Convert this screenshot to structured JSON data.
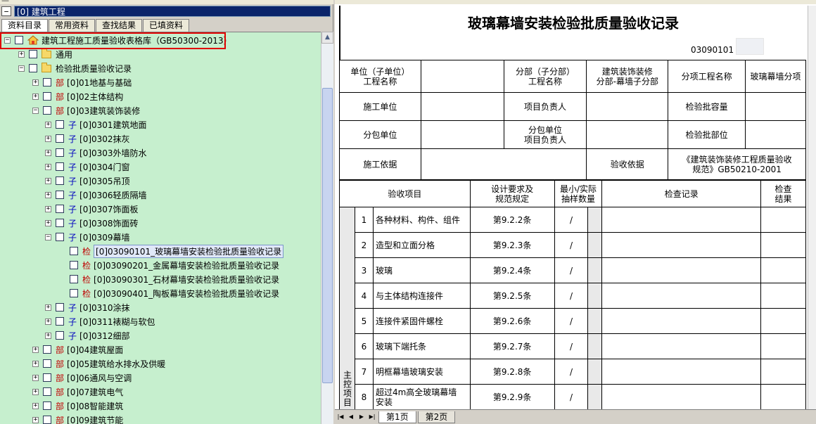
{
  "left": {
    "top_strip_text": "—",
    "project_toggle": "−",
    "project_name": "[0] 建筑工程",
    "tabs": [
      "资料目录",
      "常用资料",
      "查找结果",
      "已填资料"
    ],
    "tree": [
      {
        "id": "root",
        "exp": "−",
        "badge": "",
        "label": "建筑工程施工质量验收表格库（GB50300-2013）"
      },
      {
        "id": "tongyong",
        "exp": "+",
        "badge": "",
        "label": "通用"
      },
      {
        "id": "jianyan",
        "exp": "−",
        "badge": "",
        "label": "检验批质量验收记录"
      },
      {
        "id": "p01",
        "exp": "+",
        "badge": "部",
        "label": "[0]01地基与基础"
      },
      {
        "id": "p02",
        "exp": "+",
        "badge": "部",
        "label": "[0]02主体结构"
      },
      {
        "id": "p03",
        "exp": "−",
        "badge": "部",
        "label": "[0]03建筑装饰装修"
      },
      {
        "id": "s0301",
        "exp": "+",
        "badge": "子",
        "label": "[0]0301建筑地面"
      },
      {
        "id": "s0302",
        "exp": "+",
        "badge": "子",
        "label": "[0]0302抹灰"
      },
      {
        "id": "s0303",
        "exp": "+",
        "badge": "子",
        "label": "[0]0303外墙防水"
      },
      {
        "id": "s0304",
        "exp": "+",
        "badge": "子",
        "label": "[0]0304门窗"
      },
      {
        "id": "s0305",
        "exp": "+",
        "badge": "子",
        "label": "[0]0305吊顶"
      },
      {
        "id": "s0306",
        "exp": "+",
        "badge": "子",
        "label": "[0]0306轻质隔墙"
      },
      {
        "id": "s0307",
        "exp": "+",
        "badge": "子",
        "label": "[0]0307饰面板"
      },
      {
        "id": "s0308",
        "exp": "+",
        "badge": "子",
        "label": "[0]0308饰面砖"
      },
      {
        "id": "s0309",
        "exp": "−",
        "badge": "子",
        "label": "[0]0309幕墙"
      },
      {
        "id": "j0309001",
        "exp": "",
        "badge": "检",
        "label": "[0]03090101_玻璃幕墙安装检验批质量验收记录"
      },
      {
        "id": "j0309002",
        "exp": "",
        "badge": "检",
        "label": "[0]03090201_金属幕墙安装检验批质量验收记录"
      },
      {
        "id": "j0309003",
        "exp": "",
        "badge": "检",
        "label": "[0]03090301_石材幕墙安装检验批质量验收记录"
      },
      {
        "id": "j0309004",
        "exp": "",
        "badge": "检",
        "label": "[0]03090401_陶板幕墙安装检验批质量验收记录"
      },
      {
        "id": "s0310",
        "exp": "+",
        "badge": "子",
        "label": "[0]0310涂抹"
      },
      {
        "id": "s0311",
        "exp": "+",
        "badge": "子",
        "label": "[0]0311裱糊与软包"
      },
      {
        "id": "s0312",
        "exp": "+",
        "badge": "子",
        "label": "[0]0312细部"
      },
      {
        "id": "p04",
        "exp": "+",
        "badge": "部",
        "label": "[0]04建筑屋面"
      },
      {
        "id": "p05",
        "exp": "+",
        "badge": "部",
        "label": "[0]05建筑给水排水及供暖"
      },
      {
        "id": "p06",
        "exp": "+",
        "badge": "部",
        "label": "[0]06通风与空调"
      },
      {
        "id": "p07",
        "exp": "+",
        "badge": "部",
        "label": "[0]07建筑电气"
      },
      {
        "id": "p08",
        "exp": "+",
        "badge": "部",
        "label": "[0]08智能建筑"
      },
      {
        "id": "p09",
        "exp": "+",
        "badge": "部",
        "label": "[0]09建筑节能"
      }
    ]
  },
  "doc": {
    "title": "玻璃幕墙安装检验批质量验收记录",
    "code": "03090101",
    "header": {
      "unit_label": "单位（子单位）\n工程名称",
      "fenbu_label": "分部（子分部）\n工程名称",
      "fenbu_value": "建筑装饰装修\n分部-幕墙子分部",
      "fenxiang_label": "分项工程名称",
      "fenxiang_value": "玻璃幕墙分项",
      "shigong_label": "施工单位",
      "xiangmu_label": "项目负责人",
      "rongliang_label": "检验批容量",
      "fenbao_label": "分包单位",
      "fenbao_fz_label": "分包单位\n项目负责人",
      "buwei_label": "检验批部位",
      "yiju_label": "施工依据",
      "yanshou_label": "验收依据",
      "yanshou_value": "《建筑装饰装修工程质量验收\n规范》GB50210-2001"
    },
    "columns": {
      "item": "验收项目",
      "design": "设计要求及\n规范规定",
      "sample": "最小/实际\n抽样数量",
      "record": "检查记录",
      "result": "检查\n结果"
    },
    "group_label": "主控项目",
    "items": [
      {
        "no": "1",
        "name": "各种材料、构件、组件",
        "clause": "第9.2.2条",
        "slash": "/"
      },
      {
        "no": "2",
        "name": "造型和立面分格",
        "clause": "第9.2.3条",
        "slash": "/"
      },
      {
        "no": "3",
        "name": "玻璃",
        "clause": "第9.2.4条",
        "slash": "/"
      },
      {
        "no": "4",
        "name": "与主体结构连接件",
        "clause": "第9.2.5条",
        "slash": "/"
      },
      {
        "no": "5",
        "name": "连接件紧固件螺栓",
        "clause": "第9.2.6条",
        "slash": "/"
      },
      {
        "no": "6",
        "name": "玻璃下端托条",
        "clause": "第9.2.7条",
        "slash": "/"
      },
      {
        "no": "7",
        "name": "明框幕墙玻璃安装",
        "clause": "第9.2.8条",
        "slash": "/"
      },
      {
        "no": "8",
        "name": "超过4m高全玻璃幕墙\n安装",
        "clause": "第9.2.9条",
        "slash": "/"
      }
    ]
  },
  "sheets": [
    "第1页",
    "第2页"
  ],
  "nav": [
    "|◀",
    "◀",
    "▶",
    "▶|"
  ]
}
